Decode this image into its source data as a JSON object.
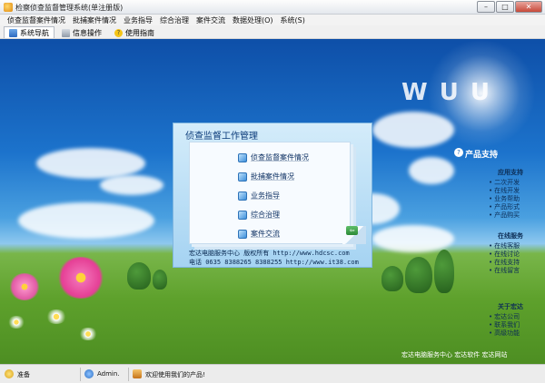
{
  "window": {
    "title": "检察侦查监督管理系统(单注册版)",
    "min_icon": "minimize-icon",
    "max_icon": "maximize-icon",
    "close_icon": "close-icon",
    "min_glyph": "–",
    "max_glyph": "□",
    "close_glyph": "✕"
  },
  "menu": [
    {
      "label": "侦查监督案件情况"
    },
    {
      "label": "批捕案件情况"
    },
    {
      "label": "业务指导"
    },
    {
      "label": "综合治理"
    },
    {
      "label": "案件交流"
    },
    {
      "label": "数据处理(O)"
    },
    {
      "label": "系统(S)"
    }
  ],
  "tabs": [
    {
      "label": "系统导航",
      "icon": "navigation-icon",
      "active": true
    },
    {
      "label": "信息操作",
      "icon": "info-icon",
      "active": false
    },
    {
      "label": "使用指南",
      "icon": "help-icon",
      "active": false,
      "glyph": "?"
    }
  ],
  "background": {
    "logo_text": "W  U U",
    "support": {
      "title": "产品支持",
      "icon_glyph": "?",
      "groups": [
        {
          "heading": "应用支持",
          "links": [
            "二次开发",
            "在线开发",
            "业务帮助",
            "产品形式",
            "产品购买"
          ]
        },
        {
          "heading": "在线服务",
          "links": [
            "在线客服",
            "在线讨论",
            "在线支持",
            "在线留言"
          ]
        },
        {
          "heading": "关于宏达",
          "links": [
            "宏达公司",
            "联系我们",
            "高级功能"
          ]
        }
      ]
    },
    "footer": "宏达电脑服务中心 宏达软件 宏达网站"
  },
  "dialog": {
    "title": "侦查监督工作管理",
    "items": [
      {
        "label": "侦查监督案件情况"
      },
      {
        "label": "批捕案件情况"
      },
      {
        "label": "业务指导"
      },
      {
        "label": "综合治理"
      },
      {
        "label": "案件交流"
      }
    ],
    "footer_line1": "宏达电脑服务中心  版权所有    http://www.hdcsc.com",
    "footer_line2": "电话 0635 8388265 8388255    http://www.it38.com",
    "exit_glyph": "⇦"
  },
  "status": {
    "ready": "准备",
    "user": "Admin.",
    "welcome": "欢迎使用我们的产品!"
  },
  "colors": {
    "sky_top": "#0e4fa8",
    "grass": "#5ea12c",
    "dialog_bg": "#a5d3f2",
    "close_red": "#c8493a"
  }
}
